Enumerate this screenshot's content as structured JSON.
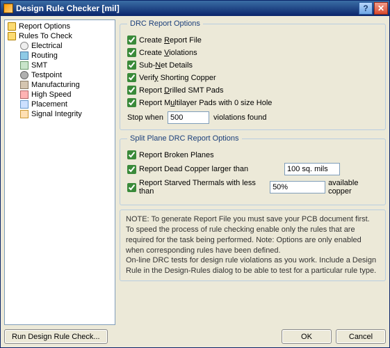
{
  "window": {
    "title": "Design Rule Checker [mil]"
  },
  "tree": {
    "items": [
      {
        "label": "Report Options",
        "icon": "ic-folder"
      },
      {
        "label": "Rules To Check",
        "icon": "ic-folder"
      },
      {
        "label": "Electrical",
        "icon": "ic-elec",
        "child": true
      },
      {
        "label": "Routing",
        "icon": "ic-route",
        "child": true
      },
      {
        "label": "SMT",
        "icon": "ic-smt",
        "child": true
      },
      {
        "label": "Testpoint",
        "icon": "ic-tp",
        "child": true
      },
      {
        "label": "Manufacturing",
        "icon": "ic-mfg",
        "child": true
      },
      {
        "label": "High Speed",
        "icon": "ic-hs",
        "child": true
      },
      {
        "label": "Placement",
        "icon": "ic-place",
        "child": true
      },
      {
        "label": "Signal Integrity",
        "icon": "ic-si",
        "child": true
      }
    ]
  },
  "drc": {
    "legend": "DRC Report Options",
    "create_report": {
      "label_pre": "Create ",
      "hk": "R",
      "label_post": "eport File",
      "checked": true
    },
    "create_violations": {
      "label_pre": "Create ",
      "hk": "V",
      "label_post": "iolations",
      "checked": true
    },
    "subnet": {
      "label_pre": "Sub-",
      "hk": "N",
      "label_post": "et Details",
      "checked": true
    },
    "shorting": {
      "label_pre": "Verif",
      "hk": "y",
      "label_post": " Shorting Copper",
      "checked": true
    },
    "drilled_smt": {
      "label_pre": "Report ",
      "hk": "D",
      "label_post": "rilled SMT Pads",
      "checked": true
    },
    "multilayer": {
      "label_pre": "Report M",
      "hk": "u",
      "label_post": "ltilayer Pads with 0 size Hole",
      "checked": true
    },
    "stop": {
      "label_pre": "Stop wh",
      "hk": "e",
      "label_post": "n",
      "value": "500",
      "suffix": "violations found"
    }
  },
  "split": {
    "legend": "Split Plane DRC Report Options",
    "broken": {
      "label": "Report Broken Planes",
      "checked": true
    },
    "dead_copper": {
      "label": "Report Dead Copper larger than",
      "checked": true,
      "value": "100 sq. mils"
    },
    "starved": {
      "label": "Report Starved Thermals with less than",
      "checked": true,
      "value": "50%",
      "suffix": "available copper"
    }
  },
  "note": {
    "l1": "NOTE: To generate Report File you must save your PCB document first.",
    "l2": "To speed the process of rule checking enable only the rules that are required for the task being performed.  Note: Options are only enabled when corresponding rules have been defined.",
    "l3": "On-line DRC tests for design rule violations as you work. Include a Design Rule in the Design-Rules dialog to be able to test for a particular rule  type."
  },
  "buttons": {
    "run": "Run Design Rule Check...",
    "ok": "OK",
    "cancel": "Cancel"
  }
}
